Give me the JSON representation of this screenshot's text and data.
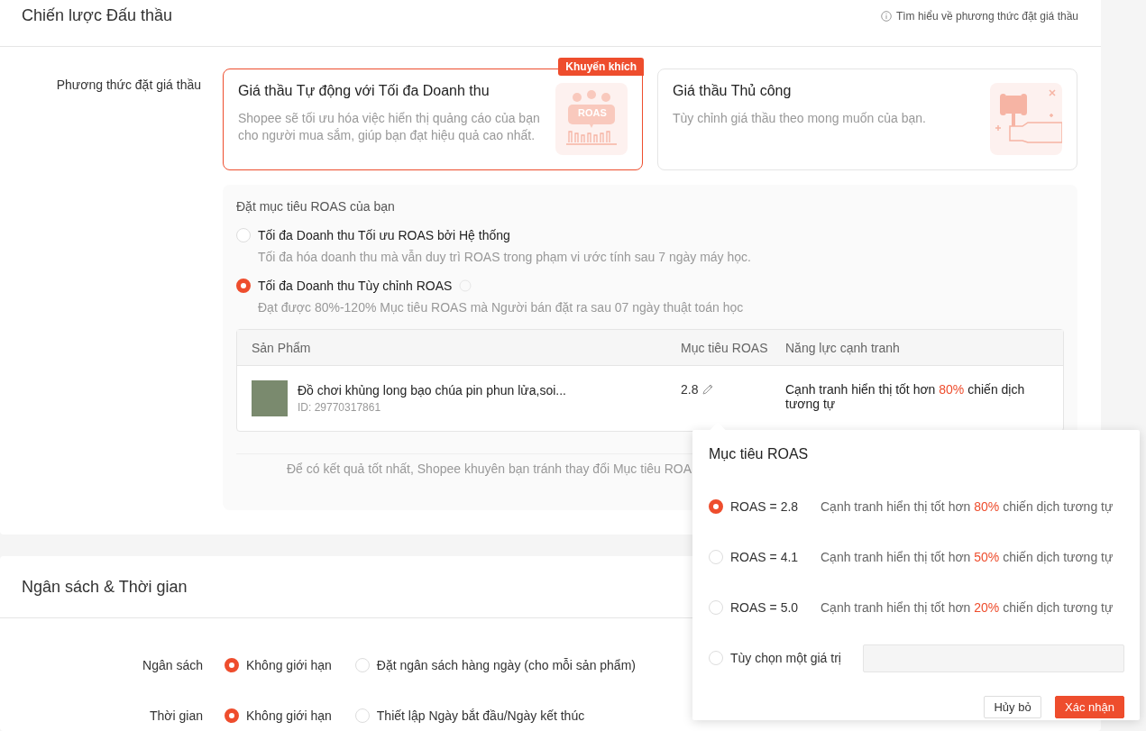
{
  "bidding_strategy": {
    "title": "Chiến lược Đấu thầu",
    "help_link": "Tìm hiểu về phương thức đặt giá thầu"
  },
  "bid_method": {
    "label": "Phương thức đặt giá thầu",
    "options": [
      {
        "kind": "auto",
        "title": "Giá thầu Tự động với Tối đa Doanh thu",
        "description": "Shopee sẽ tối ưu hóa việc hiển thị quảng cáo của bạn cho người mua sắm, giúp bạn đạt hiệu quả cao nhất.",
        "badge": "Khuyến khích",
        "icon_text": "ROAS",
        "selected": true
      },
      {
        "kind": "manual",
        "title": "Giá thầu Thủ công",
        "description": "Tùy chỉnh giá thầu theo mong muốn của bạn.",
        "selected": false
      }
    ]
  },
  "roas_target": {
    "title": "Đặt mục tiêu ROAS của bạn",
    "options": [
      {
        "label": "Tối đa Doanh thu Tối ưu ROAS bởi Hệ thống",
        "description": "Tối đa hóa doanh thu mà vẫn duy trì ROAS trong phạm vi ước tính sau 7 ngày máy học.",
        "selected": false,
        "help": false
      },
      {
        "label": "Tối đa Doanh thu Tùy chỉnh ROAS",
        "description": "Đạt được 80%-120% Mục tiêu ROAS mà Người bán đặt ra sau 07 ngày thuật toán học",
        "selected": true,
        "help": true
      }
    ],
    "table": {
      "columns": [
        "Sản Phẩm",
        "Mục tiêu ROAS",
        "Năng lực cạnh tranh"
      ],
      "rows": [
        {
          "product_name": "Đồ chơi khủng long bạo chúa pin phun lửa,soi...",
          "product_id": "ID: 29770317861",
          "roas": "2.8",
          "competitiveness": {
            "before": "Cạnh tranh hiển thị tốt hơn ",
            "highlight": "80%",
            "after": " chiến dịch tương tự"
          }
        }
      ]
    },
    "note": "Để có kết quả tốt nhất, Shopee khuyên bạn tránh thay đổi Mục tiêu ROA"
  },
  "popover": {
    "title": "Mục tiêu ROAS",
    "options": [
      {
        "kind": "preset",
        "label": "ROAS = 2.8",
        "description": {
          "before": "Cạnh tranh hiển thị tốt hơn ",
          "highlight": "80%",
          "after": " chiến dịch tương tự"
        },
        "selected": true
      },
      {
        "kind": "preset",
        "label": "ROAS = 4.1",
        "description": {
          "before": "Cạnh tranh hiển thị tốt hơn ",
          "highlight": "50%",
          "after": " chiến dịch tương tự"
        },
        "selected": false
      },
      {
        "kind": "preset",
        "label": "ROAS = 5.0",
        "description": {
          "before": "Cạnh tranh hiển thị tốt hơn ",
          "highlight": "20%",
          "after": " chiến dịch tương tự"
        },
        "selected": false
      },
      {
        "kind": "custom",
        "label": "Tùy chọn một giá trị",
        "selected": false
      }
    ],
    "buttons": [
      {
        "kind": "secondary",
        "label": "Hủy bỏ"
      },
      {
        "kind": "primary",
        "label": "Xác nhận"
      }
    ]
  },
  "budget_time": {
    "title": "Ngân sách & Thời gian",
    "rows": [
      {
        "label": "Ngân sách",
        "options": [
          {
            "label": "Không giới hạn",
            "selected": true
          },
          {
            "label": "Đặt ngân sách hàng ngày (cho mỗi sản phẩm)",
            "selected": false
          }
        ]
      },
      {
        "label": "Thời gian",
        "options": [
          {
            "label": "Không giới hạn",
            "selected": true
          },
          {
            "label": "Thiết lập Ngày bắt đầu/Ngày kết thúc",
            "selected": false
          }
        ]
      }
    ]
  }
}
